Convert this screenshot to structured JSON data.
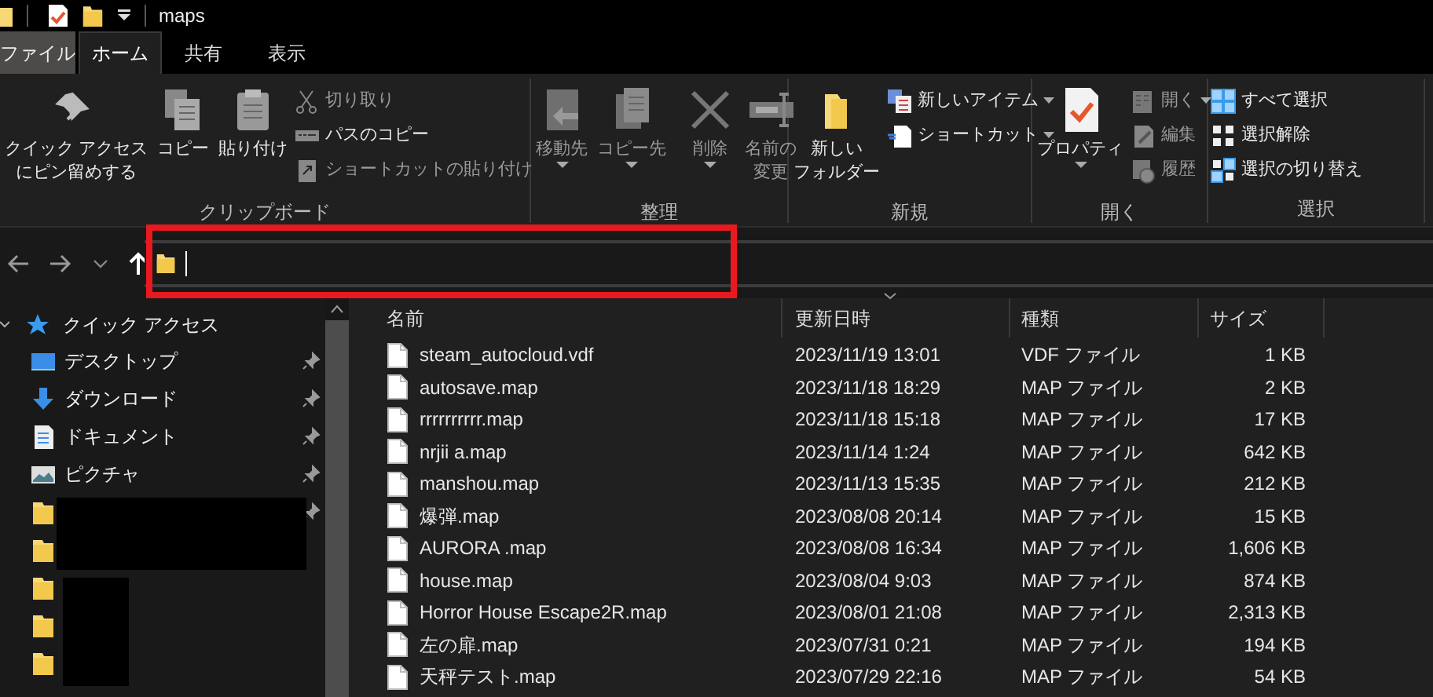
{
  "window": {
    "title": "maps"
  },
  "tabs": [
    {
      "label": "ファイル",
      "kind": "file",
      "selected": false
    },
    {
      "label": "ホーム",
      "kind": "tab",
      "selected": true
    },
    {
      "label": "共有",
      "kind": "tab",
      "selected": false
    },
    {
      "label": "表示",
      "kind": "tab",
      "selected": false
    }
  ],
  "ribbon": [
    {
      "label": "クリップボード",
      "items": [
        {
          "kind": "large",
          "lines": [
            "クイック アクセス",
            "にピン留めする"
          ],
          "disabled": false,
          "dropdown": false
        },
        {
          "kind": "large",
          "label": "コピー",
          "disabled": false,
          "dropdown": false
        },
        {
          "kind": "large",
          "label": "貼り付け",
          "disabled": false,
          "dropdown": false
        },
        {
          "kind": "small",
          "label": "切り取り",
          "disabled": true,
          "dropdown": false
        },
        {
          "kind": "small",
          "label": "パスのコピー",
          "disabled": false,
          "dropdown": false
        },
        {
          "kind": "small",
          "label": "ショートカットの貼り付け",
          "disabled": true,
          "dropdown": false
        }
      ]
    },
    {
      "label": "整理",
      "items": [
        {
          "kind": "large",
          "label": "移動先",
          "disabled": true,
          "dropdown": true
        },
        {
          "kind": "large",
          "label": "コピー先",
          "disabled": true,
          "dropdown": true
        },
        {
          "kind": "large",
          "label": "削除",
          "disabled": true,
          "dropdown": true
        },
        {
          "kind": "large",
          "lines": [
            "名前の",
            "変更"
          ],
          "disabled": true,
          "dropdown": false
        }
      ]
    },
    {
      "label": "新規",
      "items": [
        {
          "kind": "large",
          "lines": [
            "新しい",
            "フォルダー"
          ],
          "disabled": false,
          "dropdown": false
        },
        {
          "kind": "small",
          "label": "新しいアイテム",
          "disabled": false,
          "dropdown": true
        },
        {
          "kind": "small",
          "label": "ショートカット",
          "disabled": false,
          "dropdown": true
        }
      ]
    },
    {
      "label": "開く",
      "items": [
        {
          "kind": "large",
          "label": "プロパティ",
          "disabled": false,
          "dropdown": true
        },
        {
          "kind": "small",
          "label": "開く",
          "disabled": true,
          "dropdown": true
        },
        {
          "kind": "small",
          "label": "編集",
          "disabled": true,
          "dropdown": false
        },
        {
          "kind": "small",
          "label": "履歴",
          "disabled": true,
          "dropdown": false
        }
      ]
    },
    {
      "label": "選択",
      "items": [
        {
          "kind": "small",
          "label": "すべて選択",
          "disabled": false,
          "dropdown": false
        },
        {
          "kind": "small",
          "label": "選択解除",
          "disabled": false,
          "dropdown": false
        },
        {
          "kind": "small",
          "label": "選択の切り替え",
          "disabled": false,
          "dropdown": false
        }
      ]
    }
  ],
  "sidebar": {
    "header": {
      "label": "クイック アクセス",
      "expanded": true
    },
    "items": [
      {
        "kind": "desktop",
        "label": "デスクトップ",
        "pinned": true
      },
      {
        "kind": "download",
        "label": "ダウンロード",
        "pinned": true
      },
      {
        "kind": "document",
        "label": "ドキュメント",
        "pinned": true
      },
      {
        "kind": "picture",
        "label": "ピクチャ",
        "pinned": true
      },
      {
        "kind": "folder",
        "pinned": true
      },
      {
        "kind": "folder",
        "pinned": false
      },
      {
        "kind": "folder",
        "pinned": false
      },
      {
        "kind": "folder",
        "pinned": false
      },
      {
        "kind": "folder",
        "pinned": false
      }
    ]
  },
  "table": {
    "columns": [
      "名前",
      "更新日時",
      "種類",
      "サイズ"
    ],
    "rows": [
      {
        "name": "steam_autocloud.vdf",
        "modified": "2023/11/19 13:01",
        "type": "VDF ファイル",
        "size": "1 KB"
      },
      {
        "name": "autosave.map",
        "modified": "2023/11/18 18:29",
        "type": "MAP ファイル",
        "size": "2 KB"
      },
      {
        "name": "rrrrrrrrrr.map",
        "modified": "2023/11/18 15:18",
        "type": "MAP ファイル",
        "size": "17 KB"
      },
      {
        "name": "nrjii a.map",
        "modified": "2023/11/14 1:24",
        "type": "MAP ファイル",
        "size": "642 KB"
      },
      {
        "name": "manshou.map",
        "modified": "2023/11/13 15:35",
        "type": "MAP ファイル",
        "size": "212 KB"
      },
      {
        "name": "爆弾.map",
        "modified": "2023/08/08 20:14",
        "type": "MAP ファイル",
        "size": "15 KB"
      },
      {
        "name": "AURORA .map",
        "modified": "2023/08/08 16:34",
        "type": "MAP ファイル",
        "size": "1,606 KB"
      },
      {
        "name": "house.map",
        "modified": "2023/08/04 9:03",
        "type": "MAP ファイル",
        "size": "874 KB"
      },
      {
        "name": "Horror House Escape2R.map",
        "modified": "2023/08/01 21:08",
        "type": "MAP ファイル",
        "size": "2,313 KB"
      },
      {
        "name": "左の扉.map",
        "modified": "2023/07/31 0:21",
        "type": "MAP ファイル",
        "size": "194 KB"
      },
      {
        "name": "天秤テスト.map",
        "modified": "2023/07/29 22:16",
        "type": "MAP ファイル",
        "size": "54 KB"
      }
    ]
  }
}
